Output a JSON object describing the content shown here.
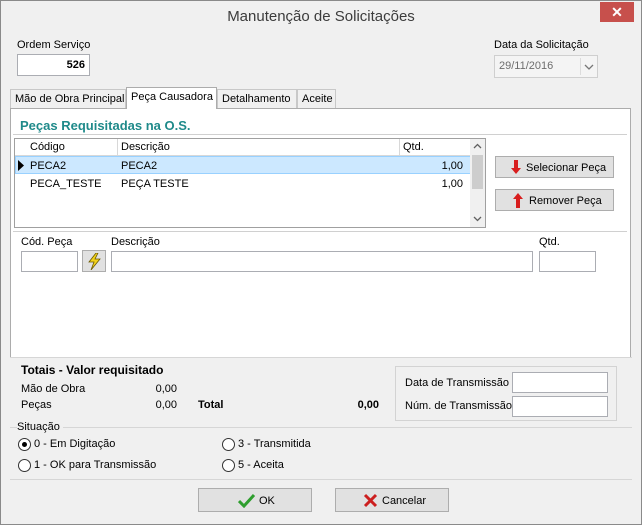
{
  "window": {
    "title": "Manutenção de Solicitações",
    "close_glyph": "✕"
  },
  "header": {
    "ordem_label": "Ordem Serviço",
    "ordem_value": "526",
    "data_label": "Data da Solicitação",
    "data_value": "29/11/2016"
  },
  "tabs": [
    {
      "label": "Mão de Obra Principal"
    },
    {
      "label": "Peça Causadora"
    },
    {
      "label": "Detalhamento"
    },
    {
      "label": "Aceite"
    }
  ],
  "pecas": {
    "section_title": "Peças Requisitadas na O.S.",
    "columns": [
      "Código",
      "Descrição",
      "Qtd."
    ],
    "rows": [
      {
        "codigo": "PECA2",
        "descricao": "PECA2",
        "qtd": "1,00"
      },
      {
        "codigo": "PECA_TESTE",
        "descricao": "PEÇA TESTE",
        "qtd": "1,00"
      }
    ],
    "select_button": "Selecionar Peça",
    "remove_button": "Remover Peça"
  },
  "form": {
    "cod_peca_label": "Cód. Peça",
    "cod_peca_value": "",
    "descricao_label": "Descrição",
    "descricao_value": "",
    "qtd_label": "Qtd.",
    "qtd_value": ""
  },
  "totais": {
    "title": "Totais - Valor requisitado",
    "mao_obra_label": "Mão de Obra",
    "mao_obra_value": "0,00",
    "pecas_label": "Peças",
    "pecas_value": "0,00",
    "total_label": "Total",
    "total_value": "0,00"
  },
  "transmissao": {
    "data_label": "Data de Transmissão",
    "data_value": "",
    "num_label": "Núm. de Transmissão",
    "num_value": ""
  },
  "situacao": {
    "label": "Situação",
    "options": [
      {
        "label": "0 - Em Digitação",
        "selected": true
      },
      {
        "label": "1 - OK para Transmissão",
        "selected": false
      },
      {
        "label": "3 - Transmitida",
        "selected": false
      },
      {
        "label": "5 - Aceita",
        "selected": false
      }
    ]
  },
  "buttons": {
    "ok": "OK",
    "cancel": "Cancelar"
  },
  "colors": {
    "section_title": "#1f8a8a",
    "close_bg": "#c7504c",
    "selection": "#cce8ff",
    "ok_check": "#2e9e2e",
    "cancel_x": "#cc1f1f",
    "arrow_red": "#d81e1e"
  }
}
